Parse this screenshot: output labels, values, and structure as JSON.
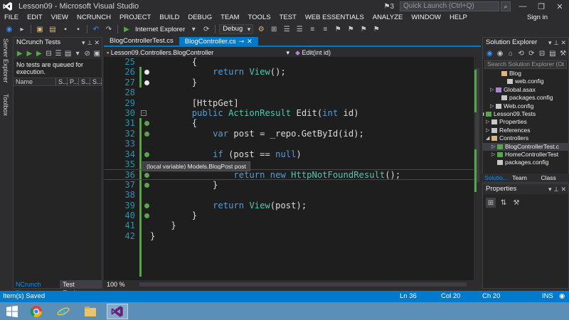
{
  "window": {
    "title": "Lesson09 - Microsoft Visual Studio",
    "notifications": "3",
    "quick_launch_placeholder": "Quick Launch (Ctrl+Q)"
  },
  "menu": [
    "FILE",
    "EDIT",
    "VIEW",
    "NCRUNCH",
    "PROJECT",
    "BUILD",
    "DEBUG",
    "TEAM",
    "TOOLS",
    "TEST",
    "WEB ESSENTIALS",
    "ANALYZE",
    "WINDOW",
    "HELP"
  ],
  "sign_in": "Sign in",
  "toolbar": {
    "browser": "Internet Explorer",
    "configuration": "Debug"
  },
  "side_tabs": {
    "server_explorer": "Server Explorer",
    "toolbox": "Toolbox"
  },
  "ncrunch": {
    "title": "NCrunch Tests",
    "message": "No tests are queued for execution.",
    "columns": [
      "Name",
      "S...",
      "P...",
      "S...",
      "S..."
    ]
  },
  "left_bottom_tabs": [
    "NCrunch Tests",
    "Test Explorer"
  ],
  "doc_tabs": [
    {
      "label": "BlogControllerTest.cs"
    },
    {
      "label": "BlogController.cs"
    }
  ],
  "nav": {
    "class": "Lesson09.Controllers.BlogController",
    "member": "Edit(int id)"
  },
  "code_lines": [
    {
      "n": "25",
      "text": "        {"
    },
    {
      "n": "26",
      "text": "            return View();"
    },
    {
      "n": "27",
      "text": "        }"
    },
    {
      "n": "28",
      "text": ""
    },
    {
      "n": "29",
      "text": "        [HttpGet]"
    },
    {
      "n": "30",
      "text": "        public ActionResult Edit(int id)"
    },
    {
      "n": "31",
      "text": "        {"
    },
    {
      "n": "32",
      "text": "            var post = _repo.GetById(id);"
    },
    {
      "n": "33",
      "text": ""
    },
    {
      "n": "34",
      "text": "            if (post == null)"
    },
    {
      "n": "35",
      "text": ""
    },
    {
      "n": "36",
      "text": "                return new HttpNotFoundResult();"
    },
    {
      "n": "37",
      "text": "            }"
    },
    {
      "n": "38",
      "text": ""
    },
    {
      "n": "39",
      "text": "            return View(post);"
    },
    {
      "n": "40",
      "text": "        }"
    },
    {
      "n": "41",
      "text": "    }"
    },
    {
      "n": "42",
      "text": "}"
    }
  ],
  "tooltip": "(local variable) Models.BlogPost post",
  "zoom": "100 %",
  "solution_explorer": {
    "title": "Solution Explorer",
    "search_placeholder": "Search Solution Explorer (Ct",
    "items": [
      "Blog",
      "web.config",
      "Global.asax",
      "packages.config",
      "Web.config",
      "Lesson09.Tests",
      "Properties",
      "References",
      "Controllers",
      "BlogControllerTest.c",
      "HomeControllerTest",
      "packages.config"
    ],
    "tabs": [
      "Solutio...",
      "Team E...",
      "Class Vi..."
    ]
  },
  "properties": {
    "title": "Properties"
  },
  "status": {
    "message": "Item(s) Saved",
    "line": "Ln 36",
    "col": "Col 20",
    "ch": "Ch 20",
    "mode": "INS"
  },
  "colors": {
    "accent": "#007acc",
    "editor_bg": "#1e1e1e",
    "keyword": "#569cd6",
    "type": "#4ec9b0",
    "line_number": "#2b91af",
    "taskbar": "#5b8fb8"
  }
}
